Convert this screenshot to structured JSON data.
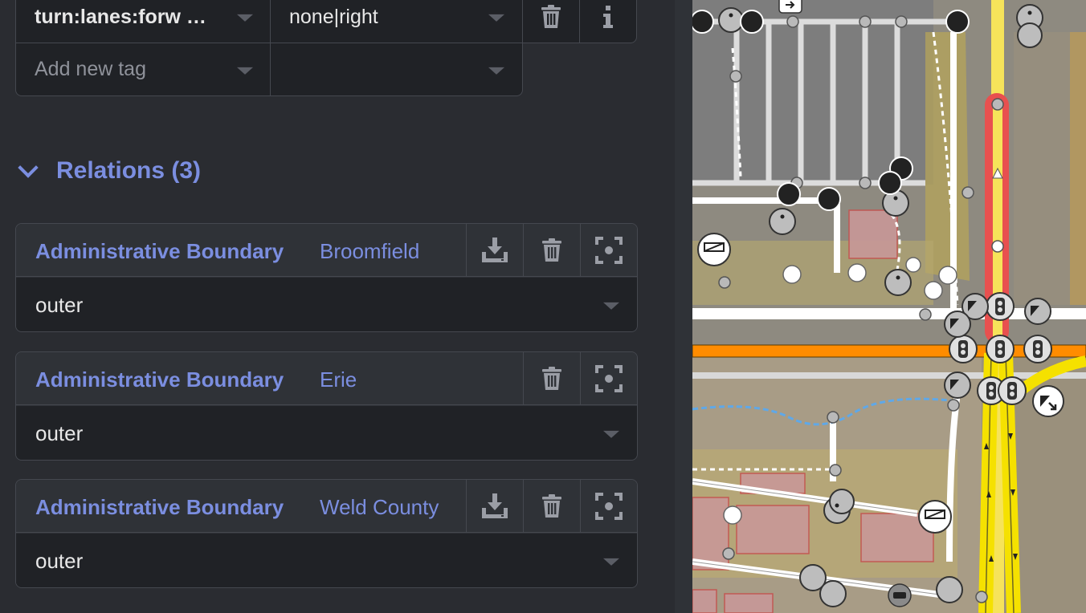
{
  "tags": [
    {
      "key": "turn:lanes:forw …",
      "value": "none|right",
      "has_buttons": true
    },
    {
      "key_placeholder": "Add new tag",
      "value": "",
      "has_buttons": false
    }
  ],
  "relations": {
    "heading": "Relations (3)",
    "items": [
      {
        "type": "Administrative Boundary",
        "name": "Broomfield",
        "role": "outer",
        "has_download": true
      },
      {
        "type": "Administrative Boundary",
        "name": "Erie",
        "role": "outer",
        "has_download": false
      },
      {
        "type": "Administrative Boundary",
        "name": "Weld County",
        "role": "outer",
        "has_download": true
      }
    ]
  },
  "icons": [
    "trash-icon",
    "info-icon",
    "download-icon",
    "zoom-to-icon",
    "chevron-down-icon"
  ],
  "colors": {
    "accent": "#7b8ee0",
    "panel_bg": "#2a2c31",
    "field_bg": "#202226",
    "border": "#45484f",
    "primary_road": "#ff8c00",
    "motorway": "#f5e100",
    "selected_way": "#e8504f"
  }
}
